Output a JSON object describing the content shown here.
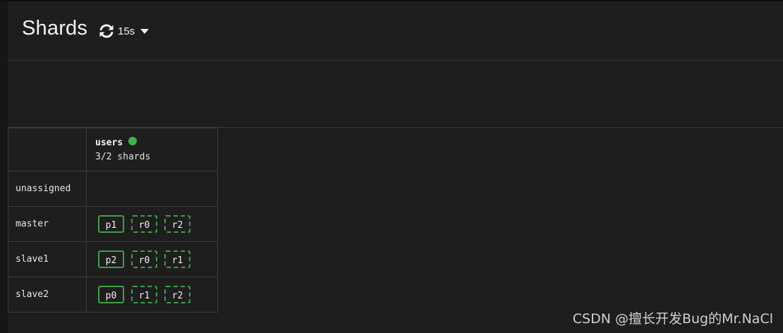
{
  "header": {
    "title": "Shards",
    "refresh_interval": "15s"
  },
  "index": {
    "name": "users",
    "shard_count": "3/2 shards",
    "status_color": "#3cb44a"
  },
  "rows": [
    {
      "node": "unassigned",
      "shards": []
    },
    {
      "node": "master",
      "shards": [
        {
          "label": "p1",
          "kind": "primary"
        },
        {
          "label": "r0",
          "kind": "replica"
        },
        {
          "label": "r2",
          "kind": "replica"
        }
      ]
    },
    {
      "node": "slave1",
      "shards": [
        {
          "label": "p2",
          "kind": "primary"
        },
        {
          "label": "r0",
          "kind": "replica"
        },
        {
          "label": "r1",
          "kind": "replica"
        }
      ]
    },
    {
      "node": "slave2",
      "shards": [
        {
          "label": "p0",
          "kind": "primary"
        },
        {
          "label": "r1",
          "kind": "replica"
        },
        {
          "label": "r2",
          "kind": "replica"
        }
      ]
    }
  ],
  "watermark": "CSDN @擅长开发Bug的Mr.NaCl"
}
